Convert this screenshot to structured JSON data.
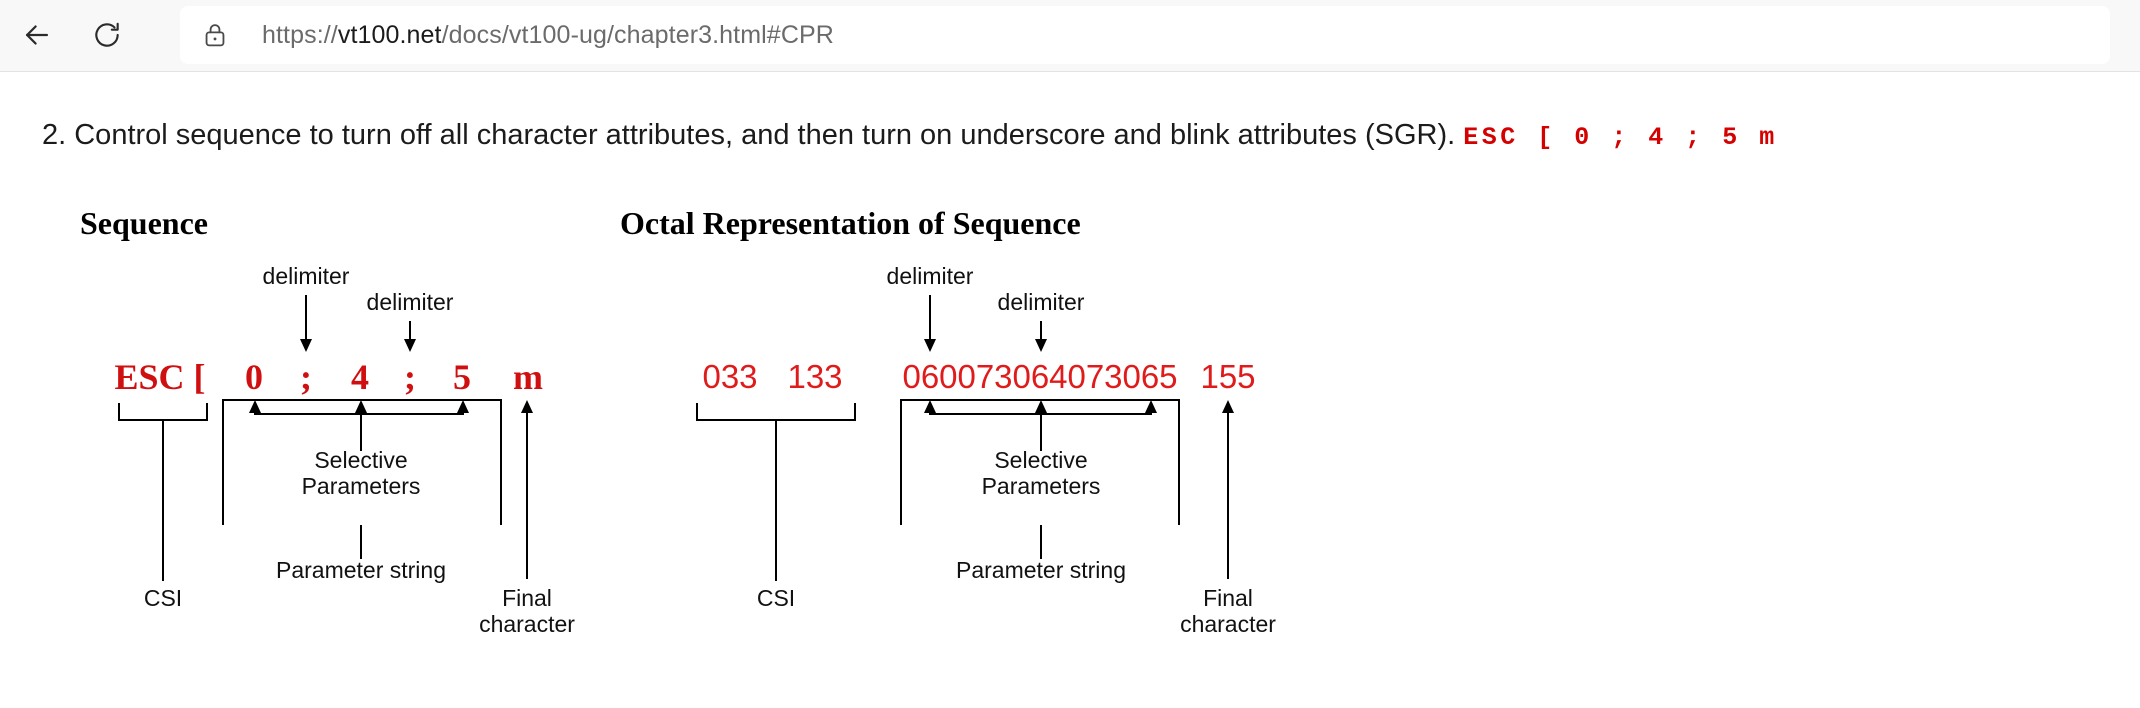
{
  "browser": {
    "back_icon": "back-arrow-icon",
    "reload_icon": "reload-icon",
    "lock_icon": "lock-icon",
    "url_scheme": "https://",
    "url_host": "vt100.net",
    "url_path": "/docs/vt100-ug/chapter3.html#CPR"
  },
  "content": {
    "paragraph": "2. Control sequence to turn off all character attributes, and then turn on underscore and blink attributes (SGR).",
    "paragraph_code": "ESC [ 0 ; 4 ; 5 m",
    "accent_red": "#d50000",
    "diagram_red": "#e01b1b",
    "ink": "#000000"
  },
  "diagrams": [
    {
      "id": "sequence",
      "title": "Sequence",
      "tokens": [
        "ESC [",
        "0",
        ";",
        "4",
        ";",
        "5",
        "m"
      ],
      "delimiter_labels": [
        "delimiter",
        "delimiter"
      ],
      "group_labels": {
        "selective_parameters": "Selective\nParameters",
        "selective_parameters_line1": "Selective",
        "selective_parameters_line2": "Parameters",
        "parameter_string": "Parameter string",
        "csi": "CSI",
        "final_character_line1": "Final",
        "final_character_line2": "character"
      }
    },
    {
      "id": "octal",
      "title": "Octal Representation of Sequence",
      "tokens": [
        "033",
        "133",
        "060",
        "073",
        "064",
        "073",
        "065",
        "155"
      ],
      "delimiter_labels": [
        "delimiter",
        "delimiter"
      ],
      "group_labels": {
        "selective_parameters_line1": "Selective",
        "selective_parameters_line2": "Parameters",
        "parameter_string": "Parameter string",
        "csi": "CSI",
        "final_character_line1": "Final",
        "final_character_line2": "character"
      }
    }
  ]
}
